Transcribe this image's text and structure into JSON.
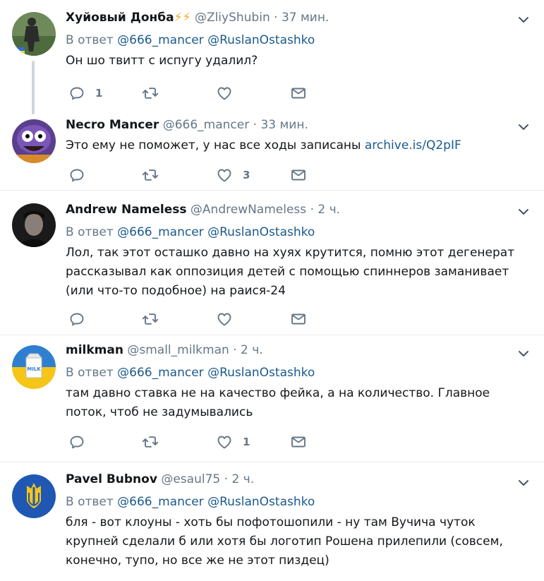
{
  "tweets": [
    {
      "name": "Хуйовый Донба",
      "emoji": "⚡⚡",
      "handle": "@ZliyShubin",
      "sep": "·",
      "time": "37 мин.",
      "reply_prefix": "В ответ",
      "reply_to": [
        "@666_mancer",
        "@RuslanOstashko"
      ],
      "text": "Он шо твитт с испугу удалил?",
      "reply_count": "1",
      "retweet_count": "",
      "like_count": ""
    },
    {
      "name": "Necro Mancer",
      "handle": "@666_mancer",
      "sep": "·",
      "time": "33 мин.",
      "text": "Это ему не поможет, у нас все ходы записаны ",
      "link": "archive.is/Q2pIF",
      "reply_count": "",
      "retweet_count": "",
      "like_count": "3"
    },
    {
      "name": "Andrew Nameless",
      "handle": "@AndrewNameless",
      "sep": "·",
      "time": "2 ч.",
      "reply_prefix": "В ответ",
      "reply_to": [
        "@666_mancer",
        "@RuslanOstashko"
      ],
      "text": "Лол, так этот осташко давно на хуях крутится, помню этот дегенерат рассказывал как оппозиция детей с помощью спиннеров заманивает (или что-то подобное) на раися-24",
      "reply_count": "",
      "retweet_count": "",
      "like_count": ""
    },
    {
      "name": "milkman",
      "handle": "@small_milkman",
      "sep": "·",
      "time": "2 ч.",
      "reply_prefix": "В ответ",
      "reply_to": [
        "@666_mancer",
        "@RuslanOstashko"
      ],
      "text": "там давно ставка не на качество фейка, а на количество. Главное поток, чтоб не задумывались",
      "reply_count": "",
      "retweet_count": "",
      "like_count": "1",
      "avatar_label": "MILK"
    },
    {
      "name": "Pavel Bubnov",
      "handle": "@esaul75",
      "sep": "·",
      "time": "2 ч.",
      "reply_prefix": "В ответ",
      "reply_to": [
        "@666_mancer",
        "@RuslanOstashko"
      ],
      "text": "бля - вот клоуны - хоть бы пофотошопили - ну там Вучича чуток крупней сделали б или хотя бы логотип Рошена прилепили (совсем, конечно, тупо, но все же не этот пиздец)",
      "reply_count": "",
      "retweet_count": "",
      "like_count": ""
    }
  ],
  "colors": {
    "text": "#14171a",
    "secondary": "#657786",
    "link": "#1b5a8c",
    "icon": "#657786",
    "divider": "#e6ecf0",
    "thread_line": "#ccd6dd"
  },
  "icons": [
    "reply-icon",
    "retweet-icon",
    "like-icon",
    "message-icon",
    "chevron-down-icon"
  ]
}
